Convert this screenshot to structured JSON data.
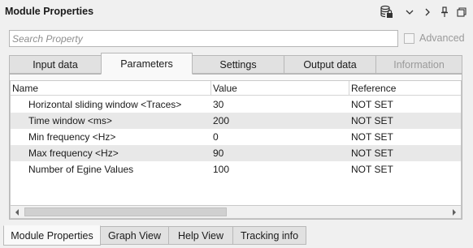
{
  "window": {
    "title": "Module Properties"
  },
  "toolbar_icons": [
    "database-lock-icon",
    "chevron-down-icon",
    "chevron-right-icon",
    "pin-icon",
    "restore-window-icon"
  ],
  "search": {
    "placeholder": "Search Property",
    "value": ""
  },
  "advanced": {
    "label": "Advanced",
    "checked": false,
    "enabled": false
  },
  "top_tabs": [
    {
      "label": "Input data",
      "active": false,
      "enabled": true
    },
    {
      "label": "Parameters",
      "active": true,
      "enabled": true
    },
    {
      "label": "Settings",
      "active": false,
      "enabled": true
    },
    {
      "label": "Output data",
      "active": false,
      "enabled": true
    },
    {
      "label": "Information",
      "active": false,
      "enabled": false
    }
  ],
  "table": {
    "columns": [
      "Name",
      "Value",
      "Reference"
    ],
    "rows": [
      {
        "name": "Horizontal sliding window <Traces>",
        "value": "30",
        "reference": "NOT SET"
      },
      {
        "name": "Time window <ms>",
        "value": "200",
        "reference": "NOT SET"
      },
      {
        "name": "Min frequency <Hz>",
        "value": "0",
        "reference": "NOT SET"
      },
      {
        "name": "Max frequency <Hz>",
        "value": "90",
        "reference": "NOT SET"
      },
      {
        "name": "Number of Egine Values",
        "value": "100",
        "reference": "NOT SET"
      }
    ]
  },
  "bottom_tabs": [
    {
      "label": "Module Properties",
      "active": true
    },
    {
      "label": "Graph View",
      "active": false
    },
    {
      "label": "Help View",
      "active": false
    },
    {
      "label": "Tracking info",
      "active": false
    }
  ]
}
